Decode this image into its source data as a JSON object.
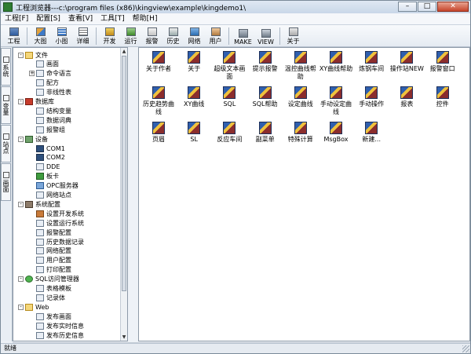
{
  "window": {
    "title": "工程浏览器---c:\\program files (x86)\\kingview\\example\\kingdemo1\\"
  },
  "menu": [
    "工程[F]",
    "配置[S]",
    "查看[V]",
    "工具[T]",
    "帮助[H]"
  ],
  "toolbar": {
    "left": [
      "工程"
    ],
    "view": [
      "大图",
      "小图",
      "详细"
    ],
    "main": [
      "开发",
      "运行",
      "报警",
      "历史",
      "网络",
      "用户"
    ],
    "make": [
      "MAKE",
      "VIEW"
    ],
    "about": [
      "关于"
    ]
  },
  "vtabs": [
    "系统",
    "变量",
    "站点",
    "画面"
  ],
  "tree": [
    {
      "label": "文件",
      "level": 0,
      "toggle": "-",
      "icon": "folder"
    },
    {
      "label": "画面",
      "level": 1,
      "icon": "page"
    },
    {
      "label": "命令语言",
      "level": 1,
      "toggle": "+",
      "icon": "page"
    },
    {
      "label": "配方",
      "level": 1,
      "icon": "page"
    },
    {
      "label": "非线性表",
      "level": 1,
      "icon": "page"
    },
    {
      "label": "数据库",
      "level": 0,
      "toggle": "-",
      "icon": "db"
    },
    {
      "label": "结构变量",
      "level": 1,
      "icon": "page"
    },
    {
      "label": "数据词典",
      "level": 1,
      "icon": "page"
    },
    {
      "label": "报警组",
      "level": 1,
      "icon": "page"
    },
    {
      "label": "设备",
      "level": 0,
      "toggle": "-",
      "icon": "dev"
    },
    {
      "label": "COM1",
      "level": 1,
      "icon": "com"
    },
    {
      "label": "COM2",
      "level": 1,
      "icon": "com"
    },
    {
      "label": "DDE",
      "level": 1,
      "icon": "page"
    },
    {
      "label": "板卡",
      "level": 1,
      "icon": "board"
    },
    {
      "label": "OPC服务器",
      "level": 1,
      "icon": "opc"
    },
    {
      "label": "网络站点",
      "level": 1,
      "icon": "page"
    },
    {
      "label": "系统配置",
      "level": 0,
      "toggle": "-",
      "icon": "sys"
    },
    {
      "label": "设置开发系统",
      "level": 1,
      "icon": "cfg"
    },
    {
      "label": "设置运行系统",
      "level": 1,
      "icon": "page"
    },
    {
      "label": "报警配置",
      "level": 1,
      "icon": "page"
    },
    {
      "label": "历史数据记录",
      "level": 1,
      "icon": "page"
    },
    {
      "label": "网络配置",
      "level": 1,
      "icon": "page"
    },
    {
      "label": "用户配置",
      "level": 1,
      "icon": "page"
    },
    {
      "label": "打印配置",
      "level": 1,
      "icon": "page"
    },
    {
      "label": "SQL访问管理器",
      "level": 0,
      "toggle": "-",
      "icon": "sql"
    },
    {
      "label": "表格模板",
      "level": 1,
      "icon": "page"
    },
    {
      "label": "记录体",
      "level": 1,
      "icon": "page"
    },
    {
      "label": "Web",
      "level": 0,
      "toggle": "-",
      "icon": "web"
    },
    {
      "label": "发布画面",
      "level": 1,
      "icon": "page"
    },
    {
      "label": "发布实时信息",
      "level": 1,
      "icon": "page"
    },
    {
      "label": "发布历史信息",
      "level": 1,
      "icon": "page"
    }
  ],
  "items": [
    "关于作者",
    "关于",
    "超级文本画面",
    "提示报警",
    "温控曲线帮助",
    "XY曲线帮助",
    "炼钢车间",
    "操作站NEW",
    "报警窗口",
    "历史趋势曲线",
    "XY曲线",
    "SQL",
    "SQL帮助",
    "设定曲线",
    "手动设定曲线",
    "手动操作",
    "报表",
    "控件",
    "页眉",
    "SL",
    "反应车间",
    "副菜单",
    "特殊计算",
    "MsgBox",
    "新建..."
  ],
  "status": "就绪"
}
